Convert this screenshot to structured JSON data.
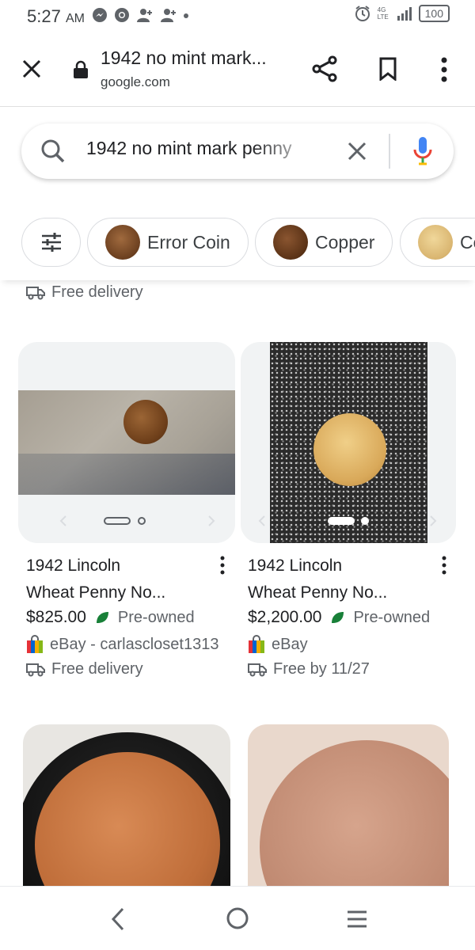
{
  "status_bar": {
    "time": "5:27",
    "ampm": "AM",
    "network": "4G LTE",
    "battery": "100"
  },
  "url_bar": {
    "page_title": "1942 no mint mark...",
    "host": "google.com"
  },
  "search": {
    "query": "1942 no mint mark penny"
  },
  "chips": [
    {
      "label": "Error Coin",
      "icon": "penny-thumbnail"
    },
    {
      "label": "Copper",
      "icon": "penny-thumbnail"
    },
    {
      "label": "Co",
      "icon": "penny-thumbnail"
    }
  ],
  "partial_row": {
    "delivery": "Free delivery"
  },
  "products": [
    {
      "title_line1": "1942 Lincoln",
      "title_line2": "Wheat Penny No...",
      "price": "$825.00",
      "condition": "Pre-owned",
      "seller": "eBay - carlascloset1313",
      "delivery": "Free delivery"
    },
    {
      "title_line1": "1942 Lincoln",
      "title_line2": "Wheat Penny No...",
      "price": "$2,200.00",
      "condition": "Pre-owned",
      "seller": "eBay",
      "delivery": "Free by 11/27"
    }
  ],
  "colors": {
    "accent": "#1a73e8",
    "leaf": "#188038",
    "mic_blue": "#4285f4",
    "mic_red": "#ea4335"
  }
}
